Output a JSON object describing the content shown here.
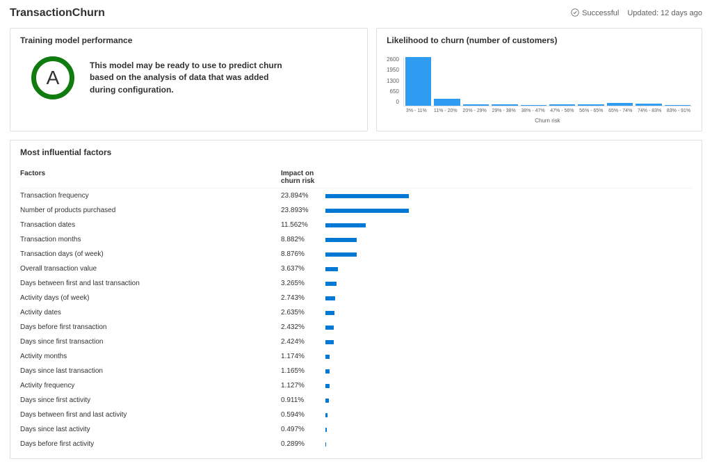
{
  "header": {
    "title": "TransactionChurn",
    "status_label": "Successful",
    "updated_label": "Updated: 12 days ago"
  },
  "training": {
    "card_title": "Training model performance",
    "grade": "A",
    "description": "This model may be ready to use to predict churn based on the analysis of data that was added during configuration."
  },
  "chart_data": {
    "type": "bar",
    "title": "Likelihood to churn (number of customers)",
    "xlabel": "Churn risk",
    "ylabel": "",
    "ylim": [
      0,
      2600
    ],
    "y_ticks": [
      2600,
      1950,
      1300,
      650,
      0
    ],
    "categories": [
      "3% - 11%",
      "11% - 20%",
      "20% - 29%",
      "29% - 38%",
      "38% - 47%",
      "47% - 56%",
      "56% - 65%",
      "65% - 74%",
      "74% - 83%",
      "83% - 91%"
    ],
    "values": [
      2550,
      380,
      90,
      60,
      50,
      80,
      70,
      150,
      100,
      50
    ]
  },
  "factors": {
    "card_title": "Most influential factors",
    "col_name_label": "Factors",
    "col_impact_label": "Impact on churn risk",
    "rows": [
      {
        "name": "Transaction frequency",
        "pct": "23.894%",
        "value": 23.894
      },
      {
        "name": "Number of products purchased",
        "pct": "23.893%",
        "value": 23.893
      },
      {
        "name": "Transaction dates",
        "pct": "11.562%",
        "value": 11.562
      },
      {
        "name": "Transaction months",
        "pct": "8.882%",
        "value": 8.882
      },
      {
        "name": "Transaction days (of week)",
        "pct": "8.876%",
        "value": 8.876
      },
      {
        "name": "Overall transaction value",
        "pct": "3.637%",
        "value": 3.637
      },
      {
        "name": "Days between first and last transaction",
        "pct": "3.265%",
        "value": 3.265
      },
      {
        "name": "Activity days (of week)",
        "pct": "2.743%",
        "value": 2.743
      },
      {
        "name": "Activity dates",
        "pct": "2.635%",
        "value": 2.635
      },
      {
        "name": "Days before first transaction",
        "pct": "2.432%",
        "value": 2.432
      },
      {
        "name": "Days since first transaction",
        "pct": "2.424%",
        "value": 2.424
      },
      {
        "name": "Activity months",
        "pct": "1.174%",
        "value": 1.174
      },
      {
        "name": "Days since last transaction",
        "pct": "1.165%",
        "value": 1.165
      },
      {
        "name": "Activity frequency",
        "pct": "1.127%",
        "value": 1.127
      },
      {
        "name": "Days since first activity",
        "pct": "0.911%",
        "value": 0.911
      },
      {
        "name": "Days between first and last activity",
        "pct": "0.594%",
        "value": 0.594
      },
      {
        "name": "Days since last activity",
        "pct": "0.497%",
        "value": 0.497
      },
      {
        "name": "Days before first activity",
        "pct": "0.289%",
        "value": 0.289
      }
    ]
  }
}
